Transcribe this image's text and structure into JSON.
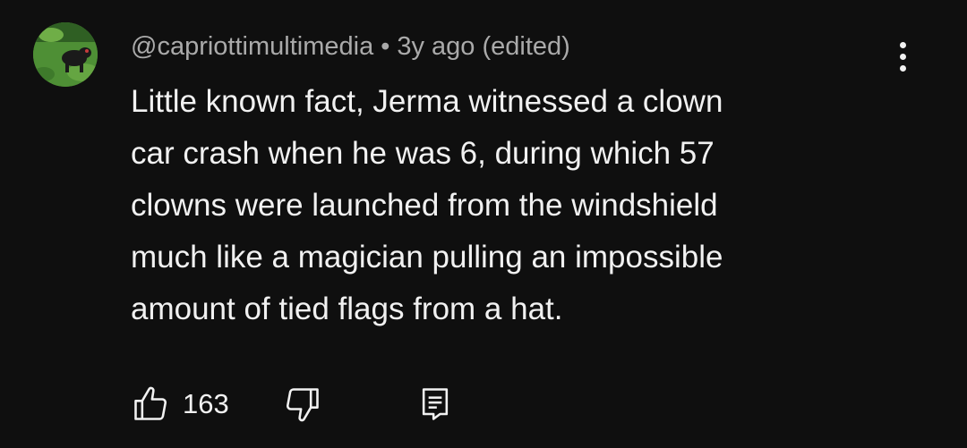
{
  "comment": {
    "author": "@capriottimultimedia",
    "separator": "•",
    "time": "3y ago (edited)",
    "body_lines": [
      "Little known fact, Jerma witnessed a clown",
      "car crash when he was 6, during which 57",
      "clowns were launched from the windshield",
      "much like a magician pulling an impossible",
      "amount of tied flags from a hat."
    ],
    "likes": "163"
  },
  "icons": {
    "more": "more-vert-icon",
    "like": "thumbs-up-icon",
    "dislike": "thumbs-down-icon",
    "reply": "reply-comment-icon"
  },
  "colors": {
    "background": "#0f0f0f",
    "text": "#f1f1f1",
    "meta_text": "#aaaaaa"
  }
}
